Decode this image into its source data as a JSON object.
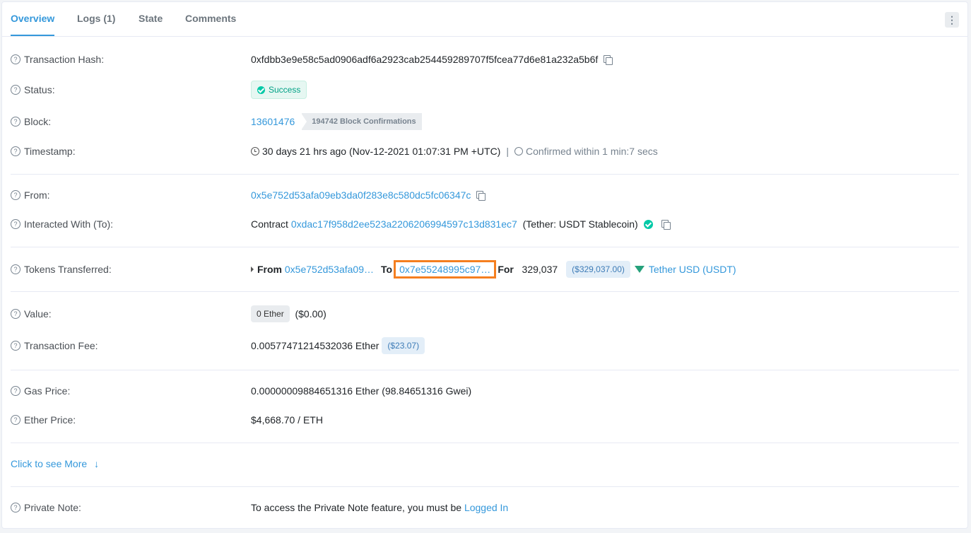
{
  "tabs": [
    {
      "label": "Overview"
    },
    {
      "label": "Logs (1)"
    },
    {
      "label": "State"
    },
    {
      "label": "Comments"
    }
  ],
  "more_icon": "⋮",
  "rows": {
    "tx_hash": {
      "label": "Transaction Hash:",
      "value": "0xfdbb3e9e58c5ad0906adf6a2923cab254459289707f5fcea77d6e81a232a5b6f"
    },
    "status": {
      "label": "Status:",
      "value": "Success"
    },
    "block": {
      "label": "Block:",
      "value": "13601476",
      "confirmations": "194742 Block Confirmations"
    },
    "timestamp": {
      "label": "Timestamp:",
      "value": "30 days 21 hrs ago (Nov-12-2021 01:07:31 PM +UTC)",
      "separator": "|",
      "confirmed": "Confirmed within 1 min:7 secs"
    },
    "from": {
      "label": "From:",
      "value": "0x5e752d53afa09eb3da0f283e8c580dc5fc06347c"
    },
    "to": {
      "label": "Interacted With (To):",
      "prefix": "Contract",
      "address": "0xdac17f958d2ee523a2206206994597c13d831ec7",
      "name": "(Tether: USDT Stablecoin)"
    },
    "tokens": {
      "label": "Tokens Transferred:",
      "from_label": "From",
      "from_addr": "0x5e752d53afa09…",
      "to_label": "To",
      "to_addr": "0x7e55248995c97…",
      "for_label": "For",
      "amount": "329,037",
      "usd": "($329,037.00)",
      "token": "Tether USD (USDT)"
    },
    "value": {
      "label": "Value:",
      "ether": "0 Ether",
      "usd": "($0.00)"
    },
    "fee": {
      "label": "Transaction Fee:",
      "value": "0.00577471214532036 Ether",
      "usd": "($23.07)"
    },
    "gas_price": {
      "label": "Gas Price:",
      "value": "0.00000009884651316 Ether (98.84651316 Gwei)"
    },
    "ether_price": {
      "label": "Ether Price:",
      "value": "$4,668.70 / ETH"
    },
    "see_more": {
      "label": "Click to see More",
      "arrow": "↓"
    },
    "private_note": {
      "label": "Private Note:",
      "text": "To access the Private Note feature, you must be",
      "link": "Logged In"
    }
  },
  "colors": {
    "accent": "#3498db",
    "success": "#00c9a7",
    "highlight": "#f57f20"
  }
}
